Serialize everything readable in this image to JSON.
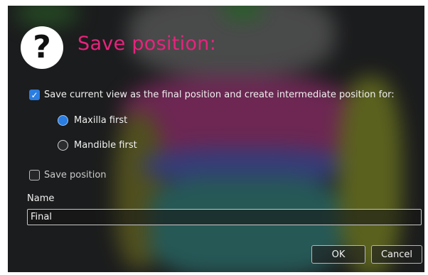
{
  "dialog": {
    "title": "Save position:",
    "help_icon_glyph": "?",
    "create_intermediate": {
      "label": "Save current view as the final position and create intermediate position for:",
      "checked": true
    },
    "radio_options": [
      {
        "label": "Maxilla first",
        "selected": true
      },
      {
        "label": "Mandible first",
        "selected": false
      }
    ],
    "save_position": {
      "label": "Save position",
      "checked": false
    },
    "name": {
      "label": "Name",
      "value": "Final"
    },
    "buttons": {
      "ok": "OK",
      "cancel": "Cancel"
    }
  },
  "colors": {
    "title": "#e8237d",
    "accent": "#2a7de1"
  },
  "icons": {
    "help": "question-circle-icon",
    "check": "checkmark-icon"
  }
}
